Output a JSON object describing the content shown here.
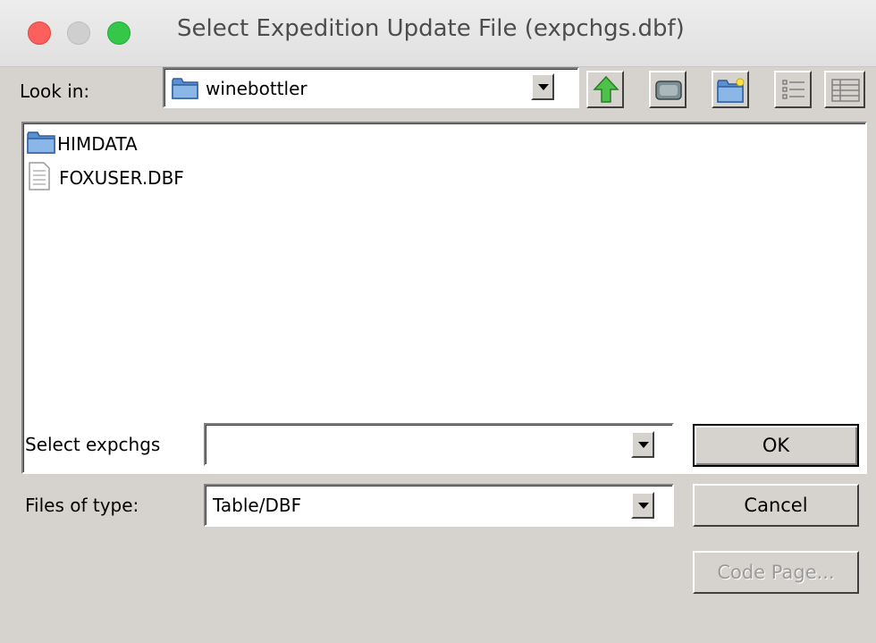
{
  "window": {
    "title": "Select Expedition Update File (expchgs.dbf)"
  },
  "lookin": {
    "label": "Look in:",
    "value": "winebottler",
    "folder_icon": "folder-icon",
    "toolbar": [
      "up-folder-icon",
      "desktop-icon",
      "new-folder-icon",
      "list-view-icon",
      "details-view-icon"
    ]
  },
  "files": [
    {
      "name": "HIMDATA",
      "icon": "folder-icon"
    },
    {
      "name": "FOXUSER.DBF",
      "icon": "file-icon"
    }
  ],
  "select": {
    "label": "Select expchgs",
    "value": ""
  },
  "filetype": {
    "label": "Files of type:",
    "value": "Table/DBF"
  },
  "buttons": {
    "ok": "OK",
    "cancel": "Cancel",
    "codepage": "Code Page..."
  },
  "colors": {
    "face": "#d6d3ce",
    "close": "#fc605c",
    "max": "#34c749",
    "disabled_text": "#9a9a9a"
  }
}
